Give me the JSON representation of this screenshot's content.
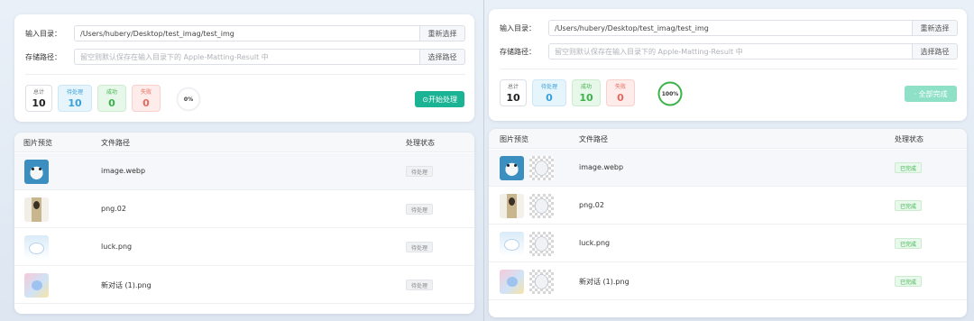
{
  "left": {
    "input_label": "输入目录：",
    "input_value": "/Users/hubery/Desktop/test_imag/test_img",
    "input_button": "重新选择",
    "save_label": "存储路径：",
    "save_placeholder": "留空则默认保存在输入目录下的 Apple-Matting-Result 中",
    "save_button": "选择路径",
    "stats": {
      "total_label": "总计",
      "total_value": "10",
      "pending_label": "待处理",
      "pending_value": "10",
      "success_label": "成功",
      "success_value": "0",
      "failed_label": "失败",
      "failed_value": "0"
    },
    "progress": {
      "text": "0%",
      "value": 0
    },
    "action_button": "⊙开始处理",
    "table": {
      "headers": {
        "preview": "图片预览",
        "path": "文件路径",
        "status": "处理状态"
      },
      "rows": [
        {
          "path": "image.webp",
          "status": "待处理"
        },
        {
          "path": "png.02",
          "status": "待处理"
        },
        {
          "path": "luck.png",
          "status": "待处理"
        },
        {
          "path": "新对话 (1).png",
          "status": "待处理"
        }
      ]
    }
  },
  "right": {
    "input_label": "输入目录：",
    "input_value": "/Users/hubery/Desktop/test_imag/test_img",
    "input_button": "重新选择",
    "save_label": "存储路径：",
    "save_placeholder": "留空则默认保存在输入目录下的 Apple-Matting-Result 中",
    "save_button": "选择路径",
    "stats": {
      "total_label": "总计",
      "total_value": "10",
      "pending_label": "待处理",
      "pending_value": "0",
      "success_label": "成功",
      "success_value": "10",
      "failed_label": "失败",
      "failed_value": "0"
    },
    "progress": {
      "text": "100%",
      "value": 100
    },
    "action_button": "· 全部完成",
    "table": {
      "headers": {
        "preview": "图片预览",
        "path": "文件路径",
        "status": "处理状态"
      },
      "rows": [
        {
          "path": "image.webp",
          "status": "已完成"
        },
        {
          "path": "png.02",
          "status": "已完成"
        },
        {
          "path": "luck.png",
          "status": "已完成"
        },
        {
          "path": "新对话 (1).png",
          "status": "已完成"
        }
      ]
    }
  },
  "colors": {
    "accent": "#1ab394",
    "success": "#3cb34a",
    "pending": "#3aa0d8",
    "failed": "#e56a5e"
  }
}
